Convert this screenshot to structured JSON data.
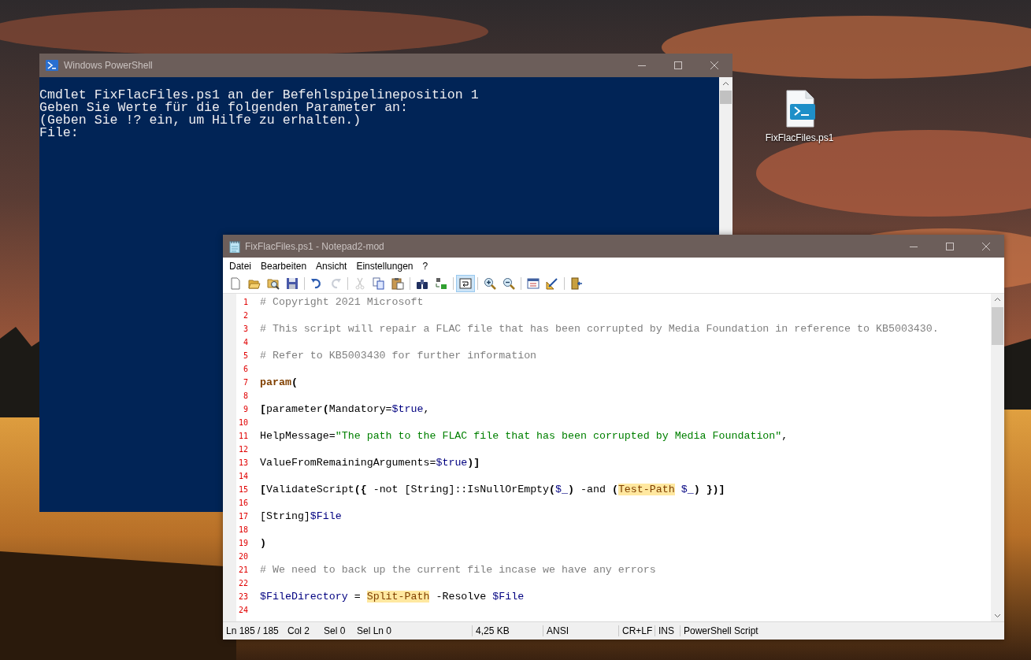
{
  "desktop_icon": {
    "label": "FixFlacFiles.ps1"
  },
  "powershell": {
    "title": "Windows PowerShell",
    "console_lines": [
      "Cmdlet FixFlacFiles.ps1 an der Befehlspipelineposition 1",
      "Geben Sie Werte für die folgenden Parameter an:",
      "(Geben Sie !? ein, um Hilfe zu erhalten.)",
      "File:"
    ]
  },
  "notepad": {
    "title": "FixFlacFiles.ps1 - Notepad2-mod",
    "menu": [
      "Datei",
      "Bearbeiten",
      "Ansicht",
      "Einstellungen",
      "?"
    ],
    "toolbar_groups": [
      {
        "buttons": [
          {
            "selected": false,
            "disabled": false
          },
          {
            "selected": false,
            "disabled": false
          },
          {
            "selected": false,
            "disabled": false
          },
          {
            "selected": false,
            "disabled": false
          }
        ]
      },
      {
        "buttons": [
          {
            "selected": false,
            "disabled": false
          },
          {
            "selected": false,
            "disabled": true
          }
        ]
      },
      {
        "buttons": [
          {
            "selected": false,
            "disabled": true
          },
          {
            "selected": false,
            "disabled": false
          },
          {
            "selected": false,
            "disabled": false
          }
        ]
      },
      {
        "buttons": [
          {
            "selected": false,
            "disabled": false
          },
          {
            "selected": false,
            "disabled": false
          }
        ]
      },
      {
        "buttons": [
          {
            "selected": true,
            "disabled": false
          }
        ]
      },
      {
        "buttons": [
          {
            "selected": false,
            "disabled": false
          },
          {
            "selected": false,
            "disabled": false
          }
        ]
      },
      {
        "buttons": [
          {
            "selected": false,
            "disabled": false
          },
          {
            "selected": false,
            "disabled": false
          }
        ]
      },
      {
        "buttons": [
          {
            "selected": false,
            "disabled": false
          }
        ]
      }
    ],
    "lines": [
      {
        "number": "1",
        "segments": [
          {
            "kind": "comment",
            "text": "# Copyright 2021 Microsoft"
          }
        ]
      },
      {
        "number": "2"
      },
      {
        "number": "3",
        "segments": [
          {
            "kind": "comment",
            "text": "# This script will repair a FLAC file that has been corrupted by Media Foundation in reference to KB5003430."
          }
        ]
      },
      {
        "number": "4"
      },
      {
        "number": "5",
        "segments": [
          {
            "kind": "comment",
            "text": "# Refer to KB5003430 for further information"
          }
        ]
      },
      {
        "number": "6"
      },
      {
        "number": "7",
        "segments": [
          {
            "kind": "keyword",
            "text": "param"
          },
          {
            "kind": "bracket",
            "text": "("
          }
        ]
      },
      {
        "number": "8"
      },
      {
        "number": "9",
        "segments": [
          {
            "kind": "bracket",
            "text": "["
          },
          {
            "kind": "text",
            "text": "parameter"
          },
          {
            "kind": "bracket",
            "text": "("
          },
          {
            "kind": "text",
            "text": "Mandatory="
          },
          {
            "kind": "var",
            "text": "$true"
          },
          {
            "kind": "text",
            "text": ","
          }
        ]
      },
      {
        "number": "10"
      },
      {
        "number": "11",
        "segments": [
          {
            "kind": "text",
            "text": "HelpMessage="
          },
          {
            "kind": "string",
            "text": "\"The path to the FLAC file that has been corrupted by Media Foundation\""
          },
          {
            "kind": "text",
            "text": ","
          }
        ]
      },
      {
        "number": "12"
      },
      {
        "number": "13",
        "segments": [
          {
            "kind": "text",
            "text": "ValueFromRemainingArguments="
          },
          {
            "kind": "var",
            "text": "$true"
          },
          {
            "kind": "bracket",
            "text": ")]"
          }
        ]
      },
      {
        "number": "14"
      },
      {
        "number": "15",
        "segments": [
          {
            "kind": "bracket",
            "text": "["
          },
          {
            "kind": "text",
            "text": "ValidateScript"
          },
          {
            "kind": "bracket",
            "text": "({"
          },
          {
            "kind": "text",
            "text": " -not [String]::IsNullOrEmpty"
          },
          {
            "kind": "bracket",
            "text": "("
          },
          {
            "kind": "var",
            "text": "$_"
          },
          {
            "kind": "bracket",
            "text": ")"
          },
          {
            "kind": "text",
            "text": " -and "
          },
          {
            "kind": "bracket",
            "text": "("
          },
          {
            "kind": "cmdlet",
            "text": "Test-Path"
          },
          {
            "kind": "var",
            "text": " $_"
          },
          {
            "kind": "bracket",
            "text": ") })]"
          }
        ]
      },
      {
        "number": "16"
      },
      {
        "number": "17",
        "segments": [
          {
            "kind": "text",
            "text": "[String]"
          },
          {
            "kind": "var",
            "text": "$File"
          }
        ]
      },
      {
        "number": "18"
      },
      {
        "number": "19",
        "segments": [
          {
            "kind": "bracket",
            "text": ")"
          }
        ]
      },
      {
        "number": "20"
      },
      {
        "number": "21",
        "segments": [
          {
            "kind": "comment",
            "text": "# We need to back up the current file incase we have any errors"
          }
        ]
      },
      {
        "number": "22"
      },
      {
        "number": "23",
        "segments": [
          {
            "kind": "var",
            "text": "$FileDirectory"
          },
          {
            "kind": "text",
            "text": " = "
          },
          {
            "kind": "cmdlet",
            "text": "Split-Path"
          },
          {
            "kind": "text",
            "text": " -Resolve "
          },
          {
            "kind": "var",
            "text": "$File"
          }
        ]
      },
      {
        "number": "24"
      }
    ],
    "status_bar": [
      "Ln 185 / 185",
      "Col 2",
      "Sel 0",
      "Sel Ln 0",
      "4,25 KB",
      "ANSI",
      "CR+LF",
      "INS",
      "PowerShell Script"
    ]
  }
}
